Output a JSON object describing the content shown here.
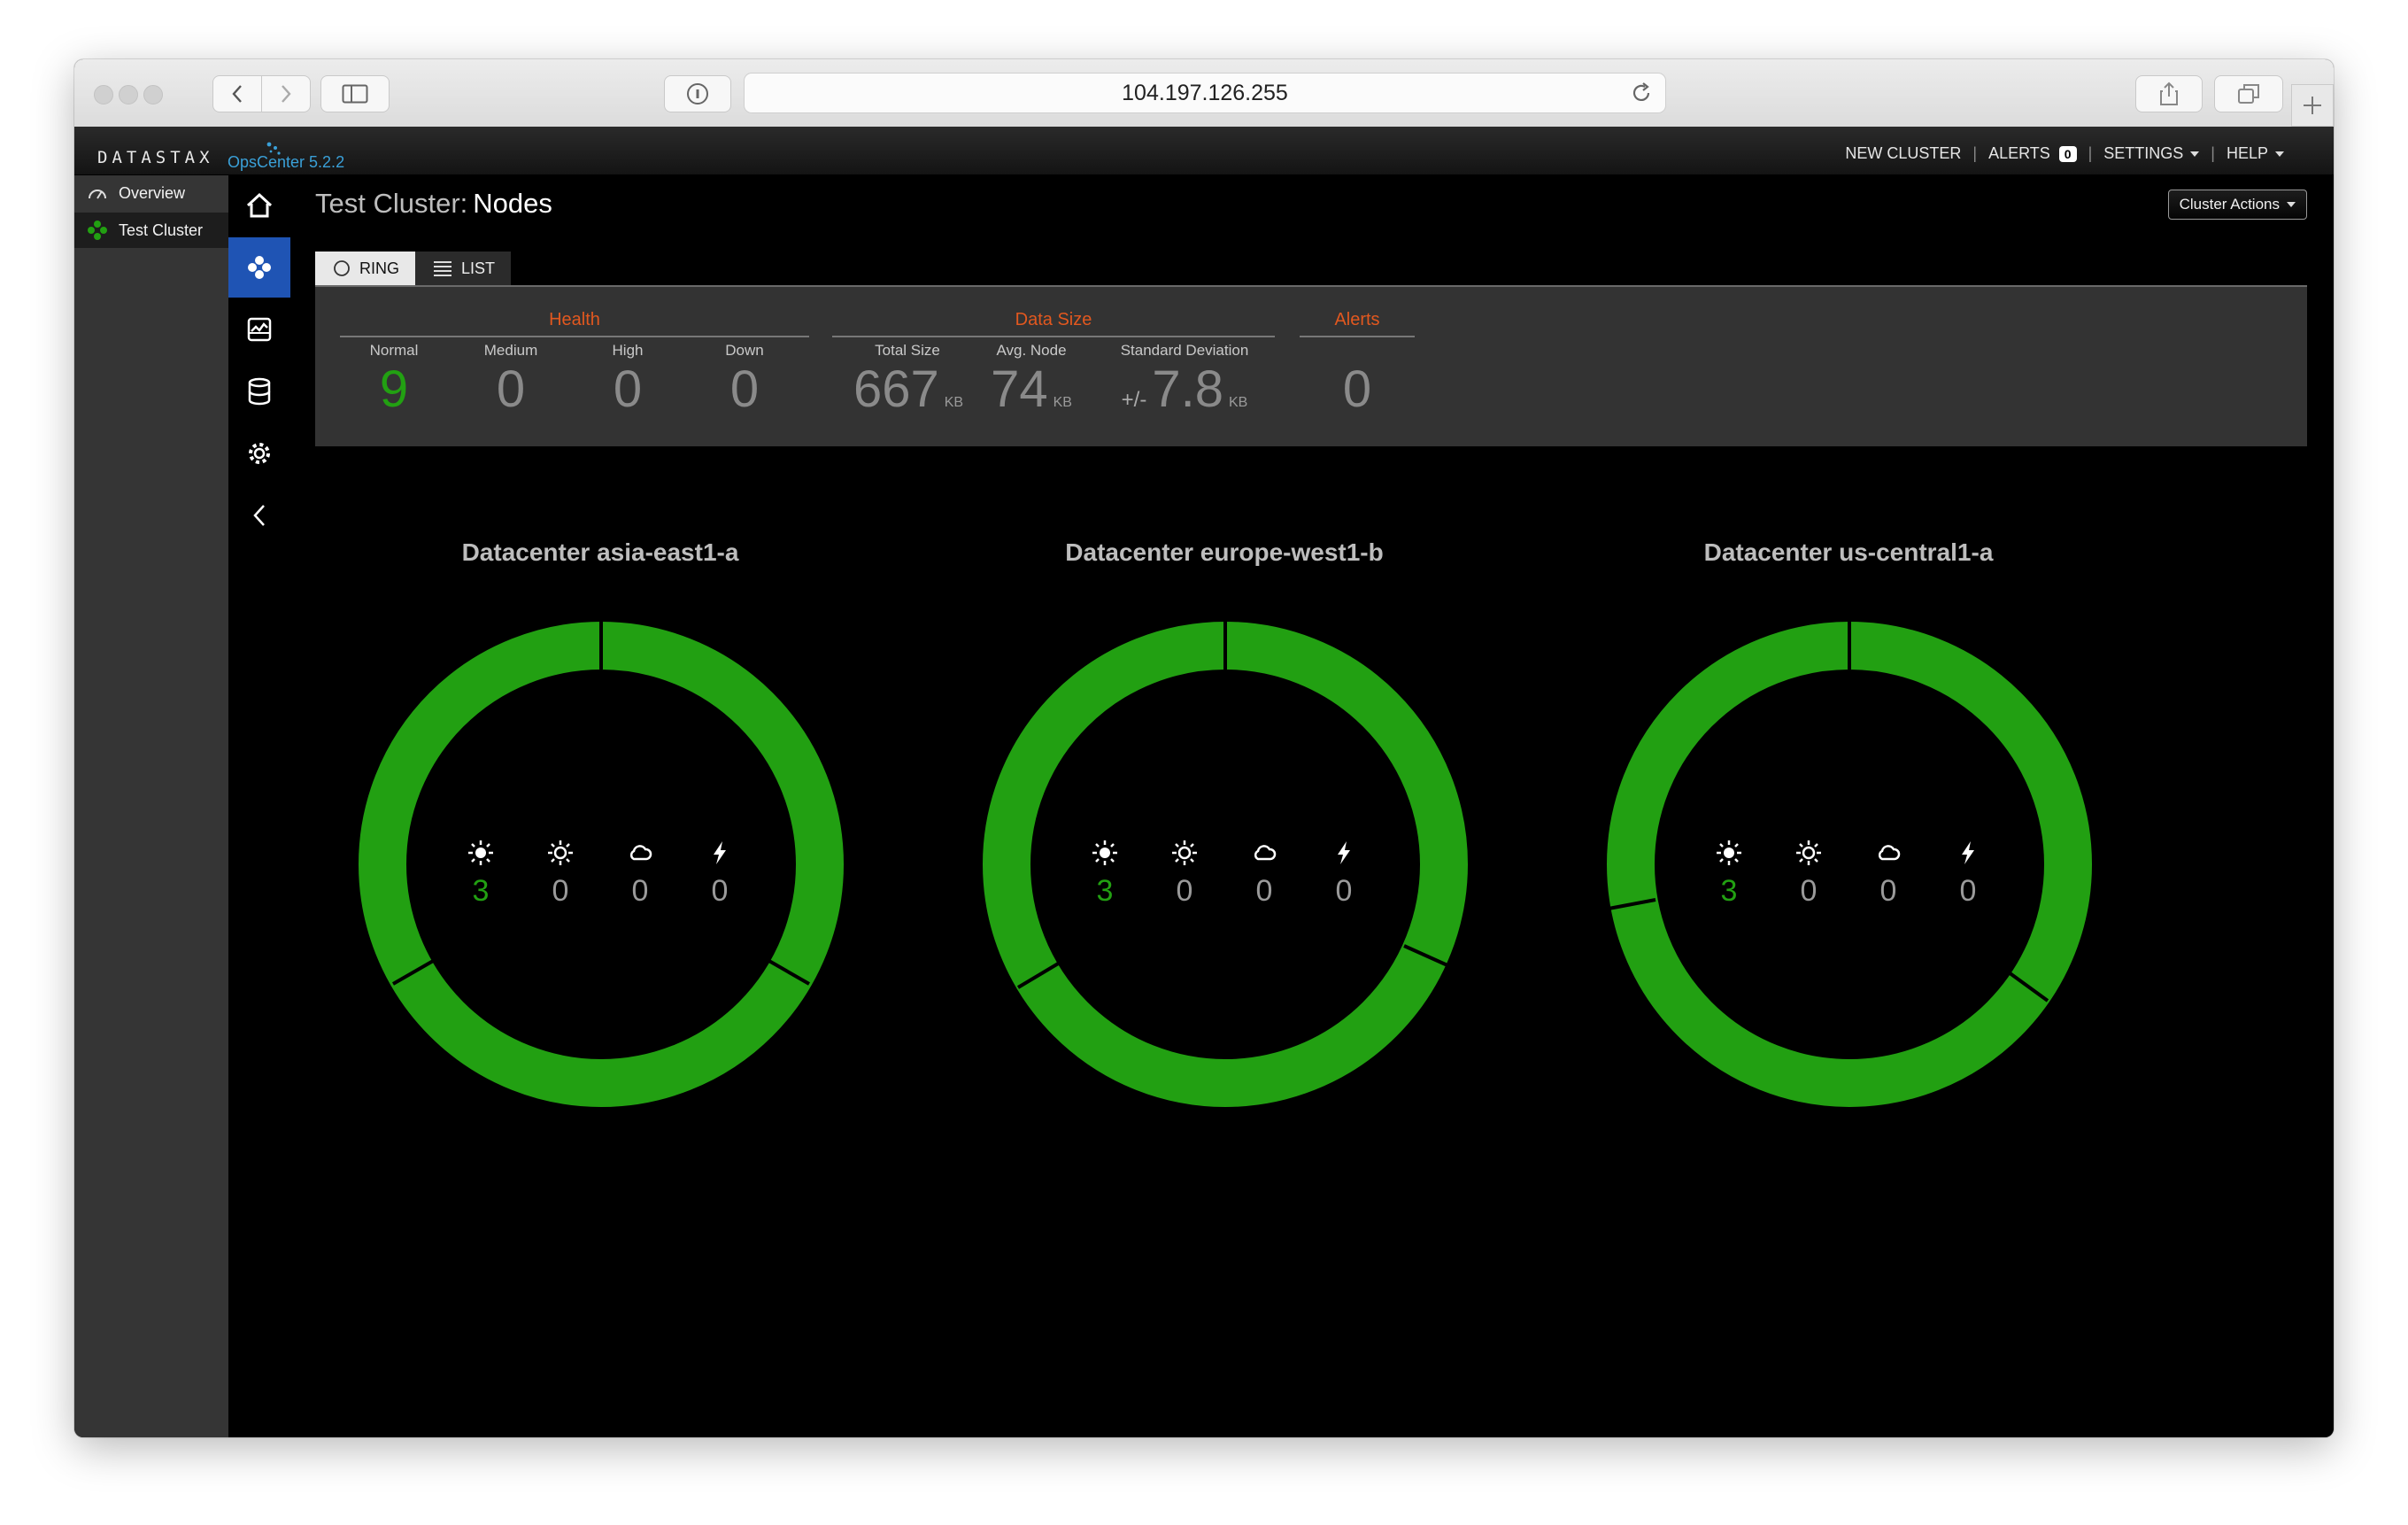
{
  "browser": {
    "url": "104.197.126.255"
  },
  "app": {
    "brand": "DATASTAX",
    "version": "OpsCenter 5.2.2",
    "nav": {
      "new_cluster": "NEW CLUSTER",
      "alerts": "ALERTS",
      "alerts_count": "0",
      "settings": "SETTINGS",
      "help": "HELP"
    }
  },
  "sidebar": {
    "items": [
      {
        "label": "Overview",
        "icon": "gauge-icon"
      },
      {
        "label": "Test Cluster",
        "icon": "cluster-icon"
      }
    ]
  },
  "rail": {
    "icons": [
      "home-icon",
      "nodes-icon",
      "dashboard-icon",
      "database-icon",
      "settings-icon",
      "collapse-icon"
    ]
  },
  "page": {
    "title_prefix": "Test Cluster:",
    "title": "Nodes",
    "cluster_actions": "Cluster Actions",
    "tabs": [
      {
        "label": "RING",
        "active": true
      },
      {
        "label": "LIST",
        "active": false
      }
    ]
  },
  "summary": {
    "health": {
      "title": "Health",
      "columns": [
        {
          "label": "Normal",
          "value": "9"
        },
        {
          "label": "Medium",
          "value": "0"
        },
        {
          "label": "High",
          "value": "0"
        },
        {
          "label": "Down",
          "value": "0"
        }
      ]
    },
    "data_size": {
      "title": "Data Size",
      "columns": [
        {
          "label": "Total Size",
          "value": "667",
          "unit": "KB"
        },
        {
          "label": "Avg. Node",
          "value": "74",
          "unit": "KB"
        },
        {
          "label": "Standard Deviation",
          "prefix": "+/-",
          "value": "7.8",
          "unit": "KB"
        }
      ]
    },
    "alerts": {
      "title": "Alerts",
      "value": "0"
    }
  },
  "colors": {
    "healthy": "#22a012",
    "accent": "#e2581f",
    "active_nav": "#1f54b4"
  },
  "datacenters": [
    {
      "name": "Datacenter asia-east1-a",
      "counts": [
        "3",
        "0",
        "0",
        "0"
      ]
    },
    {
      "name": "Datacenter europe-west1-b",
      "counts": [
        "3",
        "0",
        "0",
        "0"
      ]
    },
    {
      "name": "Datacenter us-central1-a",
      "counts": [
        "3",
        "0",
        "0",
        "0"
      ]
    }
  ],
  "status_icons": [
    "normal-sun-icon",
    "medium-sun-icon",
    "cloud-icon",
    "lightning-icon"
  ]
}
